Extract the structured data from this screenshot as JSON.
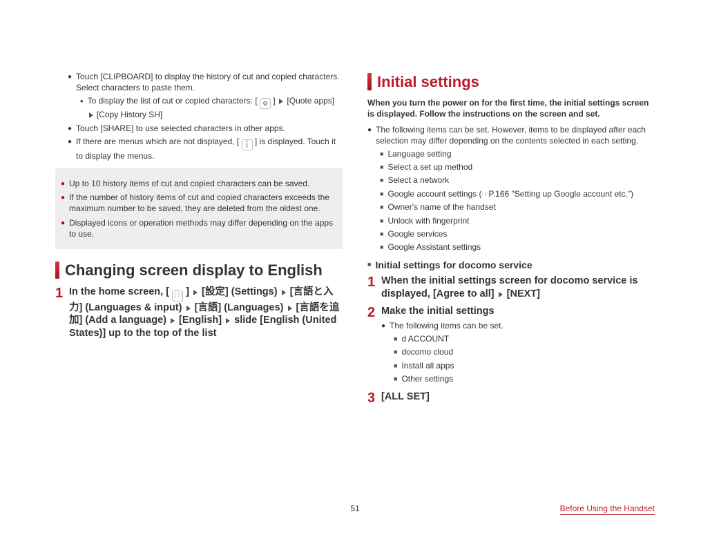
{
  "leftCol": {
    "b1": "Touch [CLIPBOARD] to display the history of cut and copied characters. Select characters to paste them.",
    "b1sub_pre": "To display the list of cut or copied characters: [",
    "b1sub_post": "[Quote apps]",
    "b1sub_last": "[Copy History SH]",
    "b2": "Touch [SHARE] to use selected characters in other apps.",
    "b3_pre": "If there are menus which are not displayed, [ ",
    "b3_post": " ] is displayed. Touch it to display the menus.",
    "note1": "Up to 10 history items of cut and copied characters can be saved.",
    "note2": "If the number of history items of cut and copied characters exceeds the maximum number to be saved, they are deleted from the oldest one.",
    "note3": "Displayed icons or operation methods may differ depending on the apps to use.",
    "h2": "Changing screen display to English",
    "step1_a": "In the home screen, [",
    "step1_b": "[設定] (Settings)",
    "step1_c": "[言語と入力] (Languages & input)",
    "step1_d": "[言語] (Languages)",
    "step1_e": "[言語を追加] (Add a language)",
    "step1_f": "[English]",
    "step1_g": "slide [English (United States)] up to the top of the list"
  },
  "rightCol": {
    "h2": "Initial settings",
    "intro": "When you turn the power on for the first time, the initial settings screen is displayed. Follow the instructions on the screen and set.",
    "b1": "The following items can be set. However, items to be displayed after each selection may differ depending on the contents selected in each setting.",
    "sq1": "Language setting",
    "sq2": "Select a set up method",
    "sq3": "Select a network",
    "sq4_pre": "Google account settings (",
    "sq4_post": "P.166 \"Setting up Google account etc.\")",
    "sq5": "Owner's name of the handset",
    "sq6": "Unlock with fingerprint",
    "sq7": "Google services",
    "sq8": "Google Assistant settings",
    "subHead": "Initial settings for docomo service",
    "step1_a": "When the initial settings screen for docomo service is displayed, [Agree to all]",
    "step1_b": "[NEXT]",
    "step2_title": "Make the initial settings",
    "step2_b1": "The following items can be set.",
    "step2_sq1": "d ACCOUNT",
    "step2_sq2": "docomo cloud",
    "step2_sq3": "Install all apps",
    "step2_sq4": "Other settings",
    "step3": "[ALL SET]"
  },
  "footer": {
    "page": "51",
    "chapter": "Before Using the Handset"
  }
}
